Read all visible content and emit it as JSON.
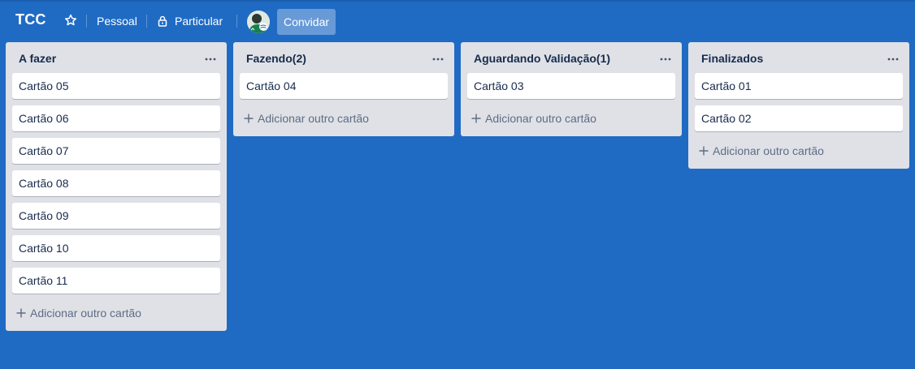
{
  "board": {
    "title": "TCC",
    "visibility_team": "Pessoal",
    "visibility": "Particular",
    "invite_label": "Convidar"
  },
  "lists": [
    {
      "title": "A fazer",
      "cards": [
        "Cartão 05",
        "Cartão 06",
        "Cartão 07",
        "Cartão 08",
        "Cartão 09",
        "Cartão 10",
        "Cartão 11"
      ],
      "add_label": "Adicionar outro cartão"
    },
    {
      "title": "Fazendo(2)",
      "cards": [
        "Cartão 04"
      ],
      "add_label": "Adicionar outro cartão"
    },
    {
      "title": "Aguardando Validação(1)",
      "cards": [
        "Cartão 03"
      ],
      "add_label": "Adicionar outro cartão"
    },
    {
      "title": "Finalizados",
      "cards": [
        "Cartão 01",
        "Cartão 02"
      ],
      "add_label": "Adicionar outro cartão"
    }
  ],
  "icons": {
    "star": "star-icon",
    "lock": "lock-icon",
    "menu": "more-horizontal-icon",
    "plus": "plus-icon"
  },
  "colors": {
    "board_background": "#1f6bc4",
    "list_background": "#dfe1e6",
    "card_background": "#ffffff",
    "text_dark": "#172b4d",
    "text_muted": "#5e6c84"
  }
}
